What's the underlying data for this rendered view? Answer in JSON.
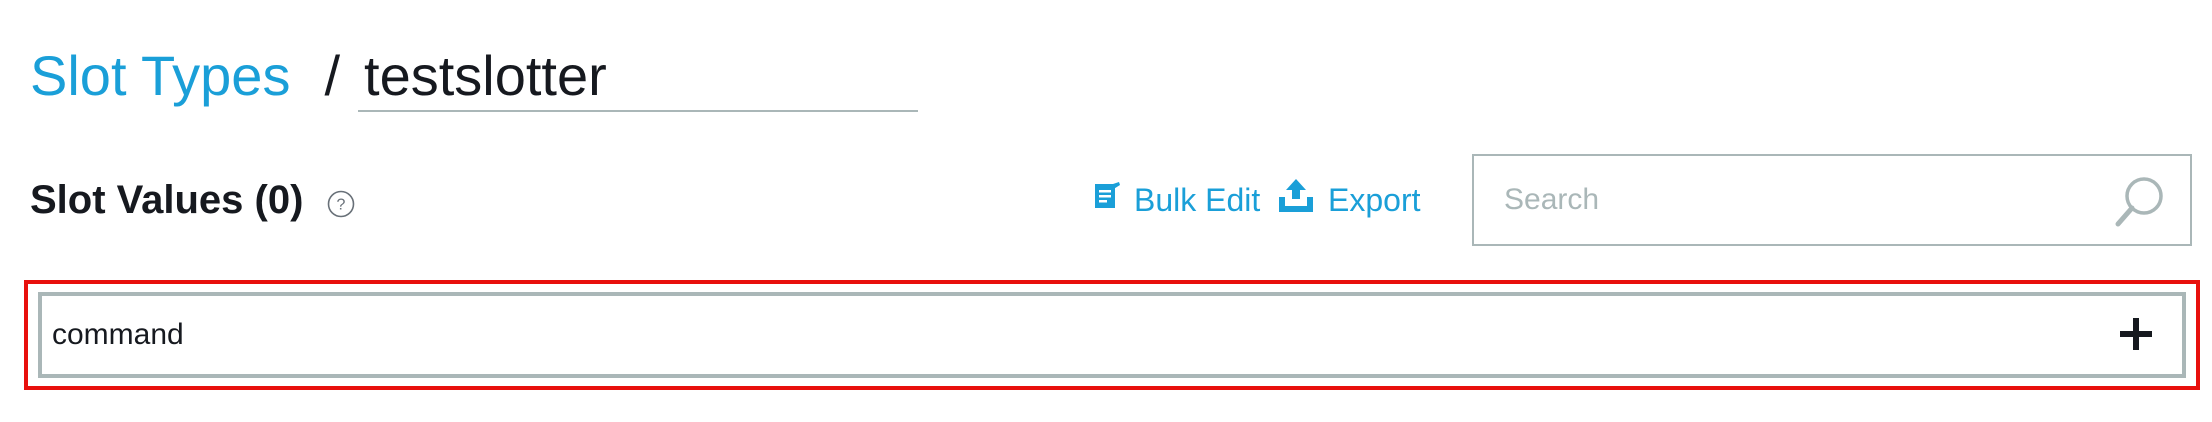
{
  "header": {
    "breadcrumb_link": "Slot Types",
    "separator": "/",
    "slot_type_name": "testslotter"
  },
  "slot_values": {
    "title": "Slot Values (0)",
    "help_icon": "question-circle-icon"
  },
  "actions": {
    "bulk_edit": {
      "label": "Bulk Edit",
      "icon": "bulk-edit-icon"
    },
    "export": {
      "label": "Export",
      "icon": "upload-icon"
    }
  },
  "search": {
    "placeholder": "Search",
    "value": "",
    "icon": "magnifier-icon"
  },
  "new_value": {
    "value": "command",
    "add_icon": "plus-icon"
  },
  "colors": {
    "link": "#1a9fd8",
    "text": "#16191f",
    "border": "#aab7b8",
    "highlight": "#e8100d"
  }
}
